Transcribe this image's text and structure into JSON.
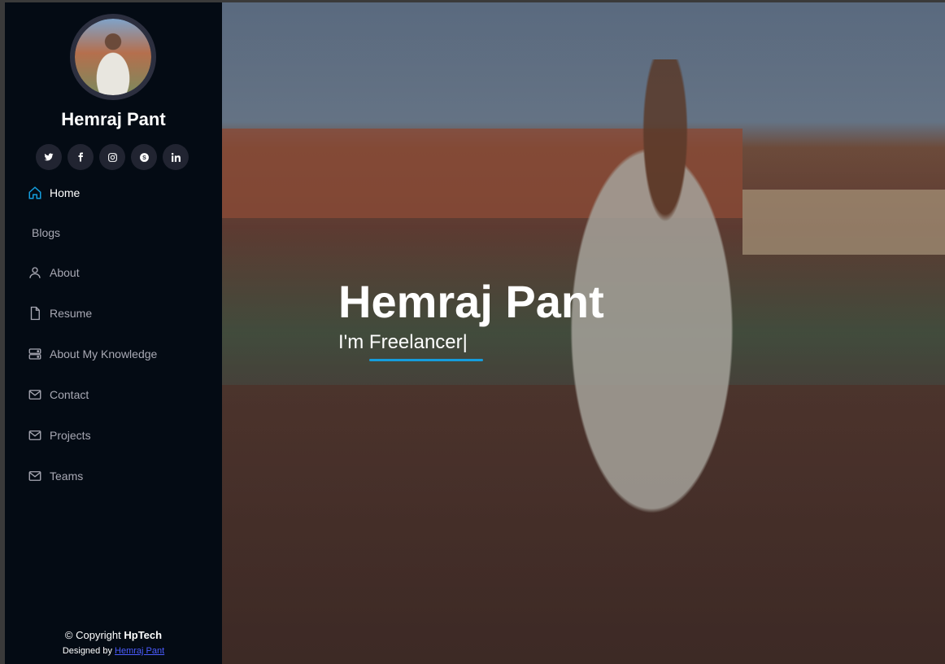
{
  "profile": {
    "name": "Hemraj Pant"
  },
  "socials": [
    {
      "icon": "twitter-icon",
      "glyph": "🐦"
    },
    {
      "icon": "facebook-icon",
      "glyph": "f"
    },
    {
      "icon": "instagram-icon",
      "glyph": "◎"
    },
    {
      "icon": "skype-icon",
      "glyph": "S"
    },
    {
      "icon": "linkedin-icon",
      "glyph": "in"
    }
  ],
  "nav": {
    "items": [
      {
        "label": "Home",
        "icon": "home-icon",
        "active": true
      },
      {
        "label": "Blogs",
        "icon": null,
        "active": false
      },
      {
        "label": "About",
        "icon": "person-icon",
        "active": false
      },
      {
        "label": "Resume",
        "icon": "file-icon",
        "active": false
      },
      {
        "label": "About My Knowledge",
        "icon": "server-icon",
        "active": false
      },
      {
        "label": "Contact",
        "icon": "envelope-icon",
        "active": false
      },
      {
        "label": "Projects",
        "icon": "envelope-icon",
        "active": false
      },
      {
        "label": "Teams",
        "icon": "envelope-icon",
        "active": false
      }
    ]
  },
  "hero": {
    "title": "Hemraj Pant",
    "subtitle": "I'm Freelancer|"
  },
  "footer": {
    "copyright_prefix": "© Copyright",
    "brand": "HpTech",
    "designed_by": "Designed by",
    "designer_link": "Hemraj Pant"
  },
  "colors": {
    "accent": "#149ddd",
    "sidebar_bg": "#040b14",
    "link": "#4b5cff"
  }
}
